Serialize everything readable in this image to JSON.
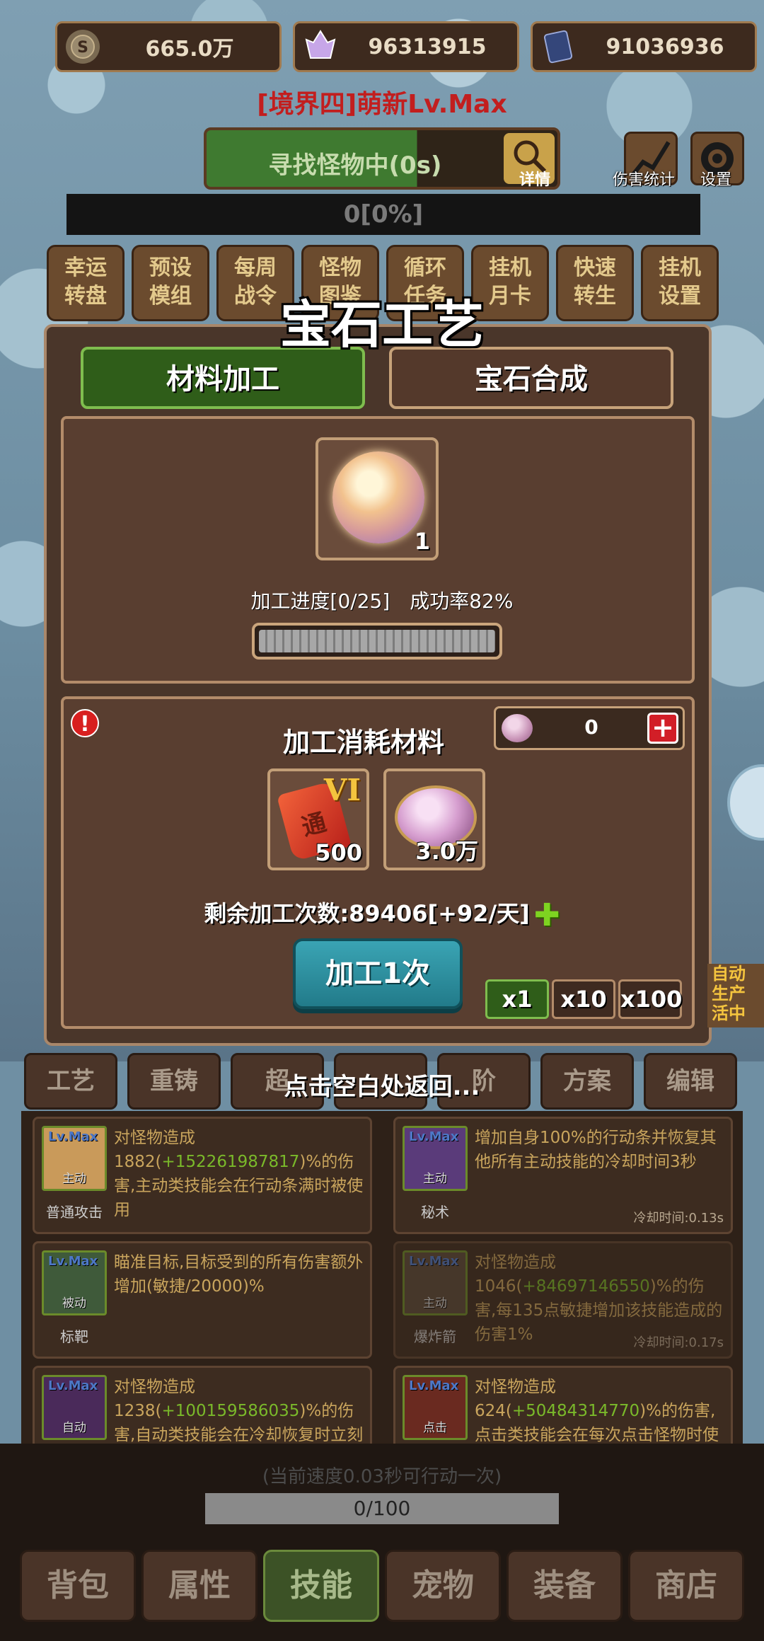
{
  "resources": [
    {
      "icon": "silver-coin-icon",
      "value": "665.0万"
    },
    {
      "icon": "crystal-icon",
      "value": "96313915"
    },
    {
      "icon": "card-icon",
      "value": "91036936"
    }
  ],
  "realm_title": "[境界四]萌新Lv.Max",
  "search": {
    "text": "寻找怪物中(0s)",
    "detail_label": "详情"
  },
  "top_icons": [
    {
      "label": "伤害统计"
    },
    {
      "label": "设置"
    }
  ],
  "xp_bar": "0[0%]",
  "menu_buttons": [
    {
      "line1": "幸运",
      "line2": "转盘"
    },
    {
      "line1": "预设",
      "line2": "模组"
    },
    {
      "line1": "每周",
      "line2": "战令"
    },
    {
      "line1": "怪物",
      "line2": "图鉴"
    },
    {
      "line1": "循环",
      "line2": "任务"
    },
    {
      "line1": "挂机",
      "line2": "月卡"
    },
    {
      "line1": "快速",
      "line2": "转生"
    },
    {
      "line1": "挂机",
      "line2": "设置"
    }
  ],
  "modal": {
    "title": "宝石工艺",
    "tabs": [
      {
        "label": "材料加工",
        "active": true
      },
      {
        "label": "宝石合成",
        "active": false
      }
    ],
    "gem_count": "1",
    "progress_text": "加工进度[0/25]　成功率82%",
    "progress": 0,
    "cost_title": "加工消耗材料",
    "material_count": "0",
    "materials": [
      {
        "icon": "tome-icon",
        "rank": "VI",
        "glyph": "通",
        "count": "500"
      },
      {
        "icon": "gem-coin-icon",
        "count": "3.0万"
      }
    ],
    "remaining": "剩余加工次数:89406[+92/天]",
    "process_button": "加工1次",
    "multipliers": [
      {
        "label": "x1",
        "active": true
      },
      {
        "label": "x10",
        "active": false
      },
      {
        "label": "x100",
        "active": false
      }
    ],
    "side_label": "自动\n生产\n活中"
  },
  "back_hint": "点击空白处返回...",
  "lower_tabs": [
    "工艺",
    "重铸",
    "超",
    "阶",
    "方案",
    "编辑"
  ],
  "skills": [
    {
      "lv": "Lv.Max",
      "type": "主动",
      "name": "普通攻击",
      "desc_pre": "对怪物造成1882(",
      "desc_hl": "+152261987817",
      "desc_post": ")%的伤害,主动类技能会在行动条满时被使用",
      "cd": ""
    },
    {
      "lv": "Lv.Max",
      "type": "主动",
      "name": "秘术",
      "desc_pre": "增加自身100%的行动条并恢复其他所有主动技能的冷却时间3秒",
      "desc_hl": "",
      "desc_post": "",
      "cd": "冷却时间:0.13s"
    },
    {
      "lv": "Lv.Max",
      "type": "被动",
      "name": "标靶",
      "desc_pre": "瞄准目标,目标受到的所有伤害额外增加(敏捷/20000)%",
      "desc_hl": "",
      "desc_post": "",
      "cd": ""
    },
    {
      "lv": "Lv.Max",
      "type": "主动",
      "name": "爆炸箭",
      "desc_pre": "对怪物造成1046(",
      "desc_hl": "+84697146550",
      "desc_post": ")%的伤害,每135点敏捷增加该技能造成的伤害1%",
      "cd": "冷却时间:0.17s"
    },
    {
      "lv": "Lv.Max",
      "type": "自动",
      "name": "",
      "desc_pre": "对怪物造成1238(",
      "desc_hl": "+100159586035",
      "desc_post": ")%的伤害,自动类技能会在冷却恢复时立刻自动使用",
      "cd": ""
    },
    {
      "lv": "Lv.Max",
      "type": "点击",
      "name": "",
      "desc_pre": "对怪物造成624(",
      "desc_hl": "+50484314770",
      "desc_post": ")%的伤害,点击类技能会在每次点击怪物时使用",
      "cd": ""
    }
  ],
  "speed_tip": "(当前速度0.03秒可行动一次)",
  "energy": "0/100",
  "nav": [
    {
      "label": "背包",
      "active": false
    },
    {
      "label": "属性",
      "active": false
    },
    {
      "label": "技能",
      "active": true
    },
    {
      "label": "宠物",
      "active": false
    },
    {
      "label": "装备",
      "active": false
    },
    {
      "label": "商店",
      "active": false
    }
  ]
}
